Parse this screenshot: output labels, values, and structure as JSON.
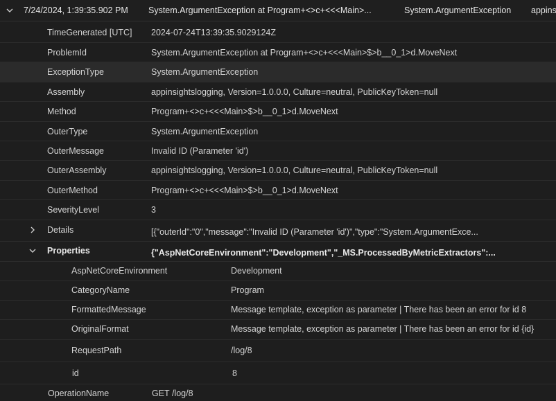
{
  "header": {
    "timestamp": "7/24/2024, 1:39:35.902 PM",
    "problem": "System.ArgumentException at Program+<>c+<<<Main>...",
    "type": "System.ArgumentException",
    "assembly": "appins"
  },
  "fields": [
    {
      "label": "TimeGenerated [UTC]",
      "value": "2024-07-24T13:39:35.9029124Z"
    },
    {
      "label": "ProblemId",
      "value": "System.ArgumentException at Program+<>c+<<<Main>$>b__0_1>d.MoveNext"
    },
    {
      "label": "ExceptionType",
      "value": "System.ArgumentException"
    },
    {
      "label": "Assembly",
      "value": "appinsightslogging, Version=1.0.0.0, Culture=neutral, PublicKeyToken=null"
    },
    {
      "label": "Method",
      "value": "Program+<>c+<<<Main>$>b__0_1>d.MoveNext"
    },
    {
      "label": "OuterType",
      "value": "System.ArgumentException"
    },
    {
      "label": "OuterMessage",
      "value": "Invalid ID (Parameter 'id')"
    },
    {
      "label": "OuterAssembly",
      "value": "appinsightslogging, Version=1.0.0.0, Culture=neutral, PublicKeyToken=null"
    },
    {
      "label": "OuterMethod",
      "value": "Program+<>c+<<<Main>$>b__0_1>d.MoveNext"
    },
    {
      "label": "SeverityLevel",
      "value": "3"
    }
  ],
  "details": {
    "label": "Details",
    "value": "[{\"outerId\":\"0\",\"message\":\"Invalid ID (Parameter 'id')\",\"type\":\"System.ArgumentExce..."
  },
  "properties": {
    "label": "Properties",
    "value": "{\"AspNetCoreEnvironment\":\"Development\",\"_MS.ProcessedByMetricExtractors\":...",
    "items": [
      {
        "label": "AspNetCoreEnvironment",
        "value": "Development"
      },
      {
        "label": "CategoryName",
        "value": "Program"
      },
      {
        "label": "FormattedMessage",
        "value": "Message template, exception as parameter | There has been an error for id 8"
      },
      {
        "label": "OriginalFormat",
        "value": "Message template, exception as parameter | There has been an error for id {id}"
      },
      {
        "label": "RequestPath",
        "value": "/log/8"
      },
      {
        "label": "id",
        "value": "8"
      }
    ]
  },
  "operation": {
    "label": "OperationName",
    "value": "GET /log/8"
  }
}
